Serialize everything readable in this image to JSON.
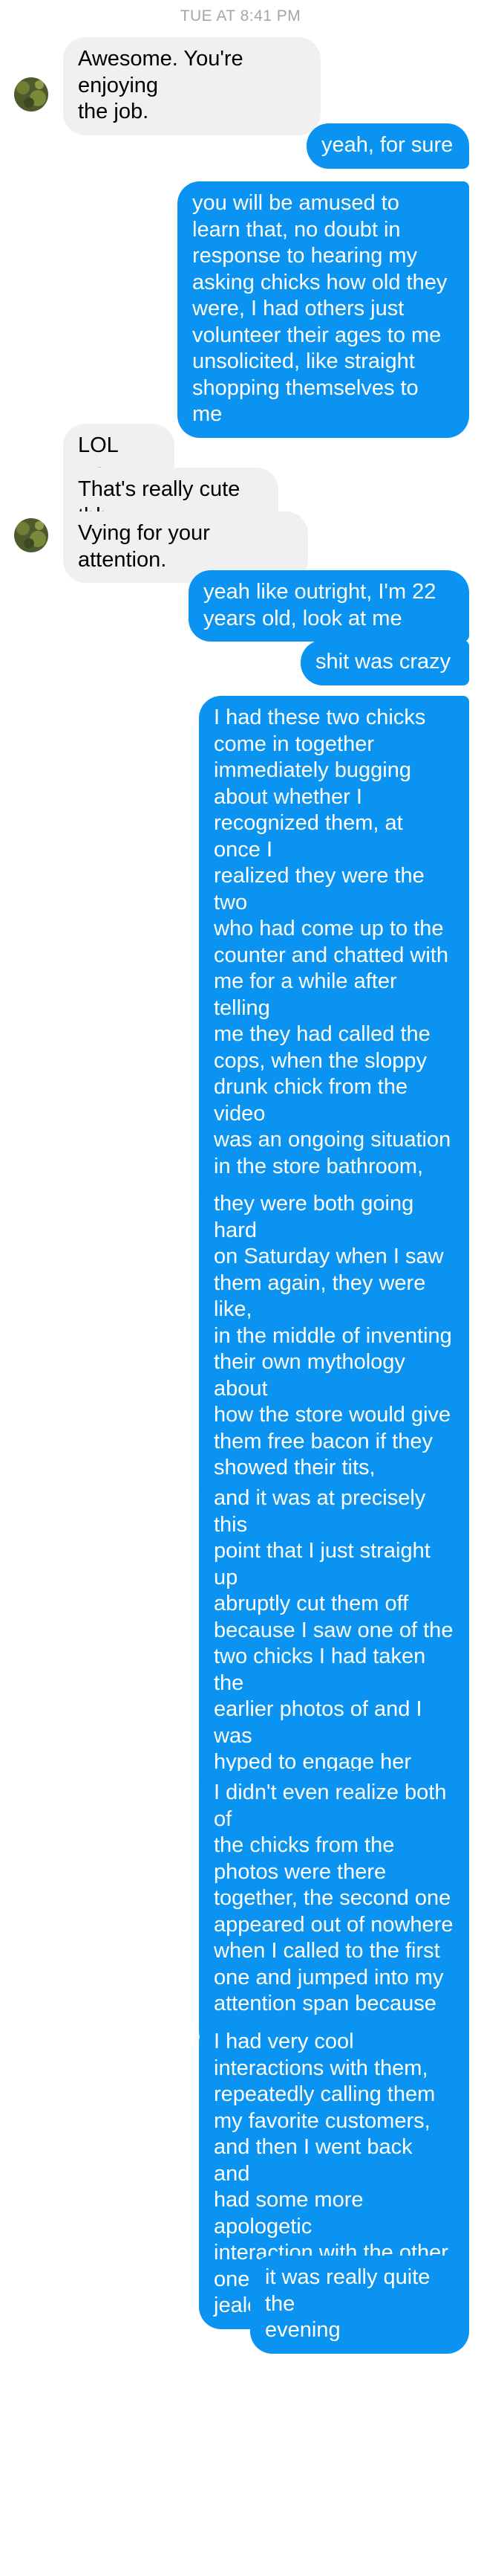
{
  "conversation": {
    "timestamp": "TUE AT 8:41 PM",
    "messages": [
      {
        "text": "Awesome. You're enjoying\nthe job."
      },
      {
        "text": "yeah, for sure"
      },
      {
        "text": "you will be amused to\nlearn that, no doubt in\nresponse to hearing my\nasking chicks how old they\nwere, I had others just\nvolunteer their ages to me\nunsolicited, like straight\nshopping themselves to\nme"
      },
      {
        "text": "LOL wow."
      },
      {
        "text": "That's really cute tbh."
      },
      {
        "text": "Vying for your attention."
      },
      {
        "text": "yeah like outright, I'm 22\nyears old, look at me"
      },
      {
        "text": "shit was crazy"
      },
      {
        "text": "I had these two chicks\ncome in together\nimmediately bugging\nabout whether I\nrecognized them, at once I\nrealized they were the two\nwho had come up to the\ncounter and chatted with\nme for a while after telling\nme they had called the\ncops, when the sloppy\ndrunk chick from the video\nwas an ongoing situation\nin the store bathroom, and\nalso realized that they had\nbeen flirting with me\nharder at that time than I\nwas aware while it was\nhappening"
      },
      {
        "text": "they were both going hard\non Saturday when I saw\nthem again, they were like,\nin the middle of inventing\ntheir own mythology about\nhow the store would give\nthem free bacon if they\nshowed their tits,\nindependently trying to\nfind a reason to show their\nboobs to me"
      },
      {
        "text": "and it was at precisely this\npoint that I just straight up\nabruptly cut them off\nbecause I saw one of the\ntwo chicks I had taken the\nearlier photos of and I was\nhyped to engage her\nagain, just outright ignored\nthe other ones and called\nto the new one right in\ntheir faces"
      },
      {
        "text": "I didn't even realize both of\nthe chicks from the\nphotos were there\ntogether, the second one\nappeared out of nowhere\nwhen I called to the first\none and jumped into my\nattention span because\nshe was hyped herself"
      },
      {
        "text": "I had very cool\ninteractions with them,\nrepeatedly calling them\nmy favorite customers,\nand then I went back and\nhad some more apologetic\ninteraction with the other\nones, who were clearly\njealous"
      },
      {
        "text": "it was really quite the\nevening"
      }
    ]
  },
  "colors": {
    "outgoing_bubble": "#0a93f0",
    "incoming_bubble": "#f1f0f0",
    "timestamp": "#a6a6a6"
  }
}
